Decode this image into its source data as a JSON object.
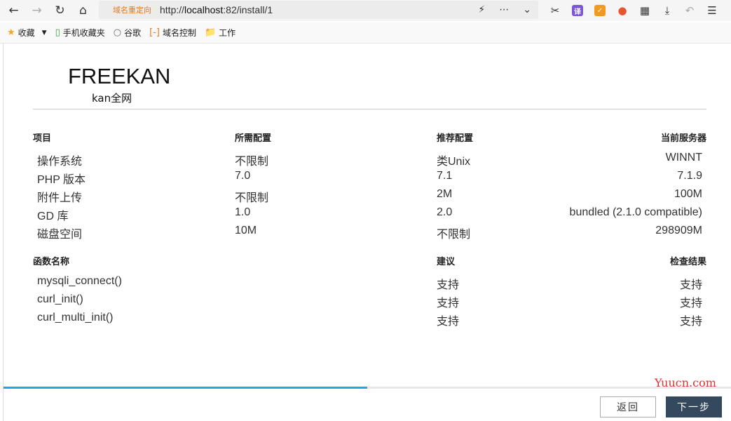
{
  "browser": {
    "url_tag": "域名重定向",
    "url_prefix": "http://",
    "url_host": "localhost",
    "url_path": ":82/install/1",
    "bookmarks": [
      "收藏",
      "手机收藏夹",
      "谷歌",
      "域名控制",
      "工作"
    ],
    "badge_translate": "译"
  },
  "page": {
    "logo": "FREEKAN",
    "sublogo": "kan全网",
    "env_headers": [
      "项目",
      "所需配置",
      "推荐配置",
      "当前服务器"
    ],
    "env_rows": [
      [
        "操作系统",
        "不限制",
        "类Unix",
        "WINNT"
      ],
      [
        "PHP 版本",
        "7.0",
        "7.1",
        "7.1.9"
      ],
      [
        "附件上传",
        "不限制",
        "2M",
        "100M"
      ],
      [
        "GD 库",
        "1.0",
        "2.0",
        "bundled (2.1.0 compatible)"
      ],
      [
        "磁盘空间",
        "10M",
        "不限制",
        "298909M"
      ]
    ],
    "func_headers": [
      "函数名称",
      "建议",
      "检查结果"
    ],
    "func_rows": [
      [
        "mysqli_connect()",
        "支持",
        "支持"
      ],
      [
        "curl_init()",
        "支持",
        "支持"
      ],
      [
        "curl_multi_init()",
        "支持",
        "支持"
      ]
    ],
    "progress": 0.5,
    "back_label": "返回",
    "next_label": "下一步",
    "watermark": "Yuucn.com"
  }
}
